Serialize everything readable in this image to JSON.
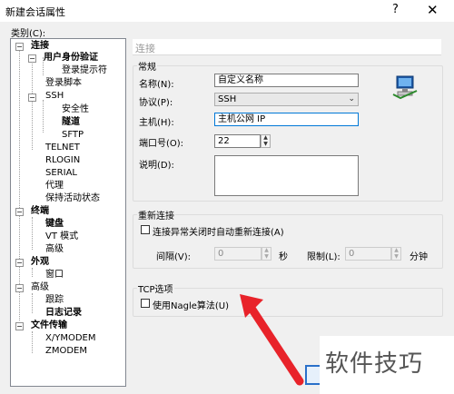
{
  "window": {
    "title": "新建会话属性",
    "help_glyph": "?",
    "close_glyph": "✕"
  },
  "category_label": "类别(C):",
  "tree": [
    {
      "label": "连接",
      "expander": "−"
    },
    {
      "label": "用户身份验证",
      "expander": "−"
    },
    {
      "label": "登录提示符"
    },
    {
      "label": "登录脚本"
    },
    {
      "label": "SSH",
      "expander": "−"
    },
    {
      "label": "安全性"
    },
    {
      "label": "隧道"
    },
    {
      "label": "SFTP"
    },
    {
      "label": "TELNET"
    },
    {
      "label": "RLOGIN"
    },
    {
      "label": "SERIAL"
    },
    {
      "label": "代理"
    },
    {
      "label": "保持活动状态"
    },
    {
      "label": "终端",
      "expander": "−"
    },
    {
      "label": "键盘"
    },
    {
      "label": "VT 模式"
    },
    {
      "label": "高级"
    },
    {
      "label": "外观",
      "expander": "−"
    },
    {
      "label": "窗口"
    },
    {
      "label": "高级",
      "expander": "−"
    },
    {
      "label": "跟踪"
    },
    {
      "label": "日志记录"
    },
    {
      "label": "文件传输",
      "expander": "−"
    },
    {
      "label": "X/YMODEM"
    },
    {
      "label": "ZMODEM"
    }
  ],
  "section_header": "连接",
  "general": {
    "title": "常规",
    "name_label": "名称(N):",
    "name_value": "自定义名称",
    "protocol_label": "协议(P):",
    "protocol_value": "SSH",
    "host_label": "主机(H):",
    "host_value": "主机公网 IP",
    "port_label": "端口号(O):",
    "port_value": "22",
    "description_label": "说明(D):"
  },
  "reconnect": {
    "title": "重新连接",
    "auto_label": "连接异常关闭时自动重新连接(A)",
    "interval_label": "间隔(V):",
    "interval_value": "0",
    "interval_unit": "秒",
    "limit_label": "限制(L):",
    "limit_value": "0",
    "limit_unit": "分钟"
  },
  "tcp": {
    "title": "TCP选项",
    "nagle_label": "使用Nagle算法(U)"
  },
  "watermark": "软件技巧",
  "colors": {
    "annotation_arrow": "#e8232a",
    "focus_border": "#0078d7"
  }
}
